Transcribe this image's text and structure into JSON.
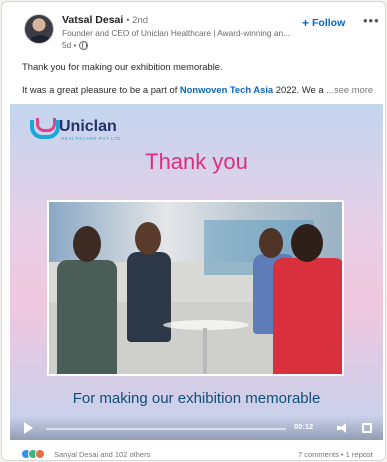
{
  "post": {
    "author_name": "Vatsal Desai",
    "degree": "• 2nd",
    "author_subtitle": "Founder and CEO of Uniclan Healthcare | Award-winning an...",
    "time": "5d •",
    "follow_label": "Follow",
    "follow_icon": "+",
    "more_icon": "•••",
    "text_line1": "Thank you for making our exhibition memorable.",
    "text_line2_prefix": "It was a great pleasure to be a part of ",
    "text_line2_link": "Nonwoven Tech Asia",
    "text_line2_suffix": " 2022. We a",
    "see_more": "...see more"
  },
  "media": {
    "logo_text": "Uniclan",
    "logo_sub": "HEALTHCARE PVT LTD",
    "headline": "Thank you",
    "tagline": "For making our exhibition memorable",
    "video_time": "00:12",
    "colors": {
      "headline": "#df2d82",
      "tagline": "#0f4f73",
      "logo_text": "#25306a",
      "logo_accent": "#1ba6d9"
    }
  },
  "footer": {
    "reactions_text": "Sanyal Desai and 102 others",
    "comments_text": "7 comments • 1 repost",
    "reaction_icons": [
      "like-icon",
      "celebrate-icon",
      "love-icon"
    ]
  },
  "accent_color": "#0a66c2"
}
